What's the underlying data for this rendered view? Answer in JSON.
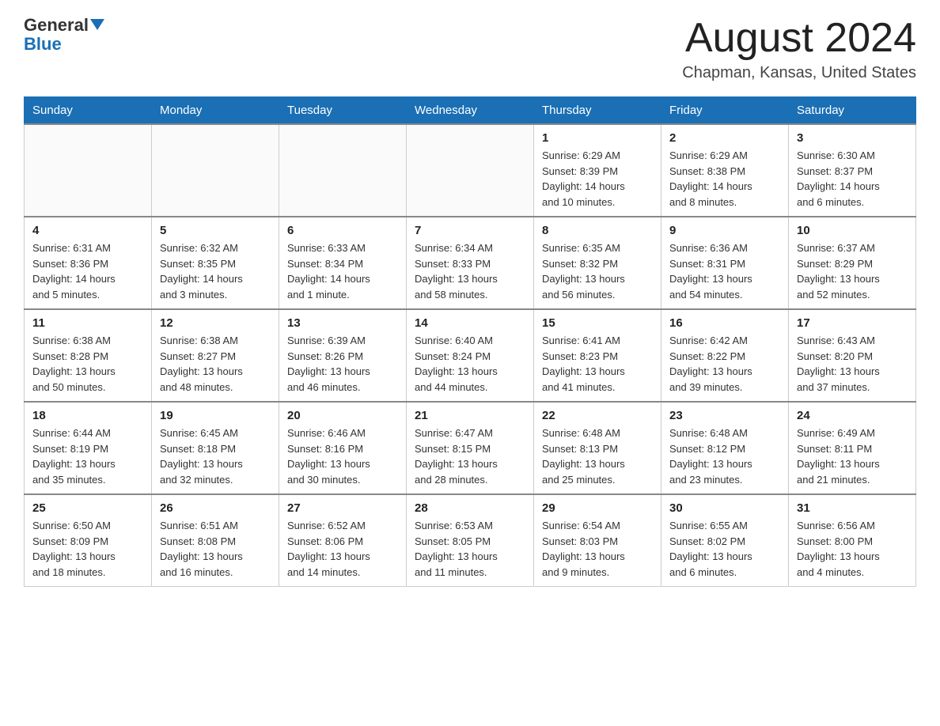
{
  "logo": {
    "text_general": "General",
    "text_blue": "Blue"
  },
  "title": "August 2024",
  "location": "Chapman, Kansas, United States",
  "weekdays": [
    "Sunday",
    "Monday",
    "Tuesday",
    "Wednesday",
    "Thursday",
    "Friday",
    "Saturday"
  ],
  "weeks": [
    [
      {
        "day": "",
        "info": ""
      },
      {
        "day": "",
        "info": ""
      },
      {
        "day": "",
        "info": ""
      },
      {
        "day": "",
        "info": ""
      },
      {
        "day": "1",
        "info": "Sunrise: 6:29 AM\nSunset: 8:39 PM\nDaylight: 14 hours\nand 10 minutes."
      },
      {
        "day": "2",
        "info": "Sunrise: 6:29 AM\nSunset: 8:38 PM\nDaylight: 14 hours\nand 8 minutes."
      },
      {
        "day": "3",
        "info": "Sunrise: 6:30 AM\nSunset: 8:37 PM\nDaylight: 14 hours\nand 6 minutes."
      }
    ],
    [
      {
        "day": "4",
        "info": "Sunrise: 6:31 AM\nSunset: 8:36 PM\nDaylight: 14 hours\nand 5 minutes."
      },
      {
        "day": "5",
        "info": "Sunrise: 6:32 AM\nSunset: 8:35 PM\nDaylight: 14 hours\nand 3 minutes."
      },
      {
        "day": "6",
        "info": "Sunrise: 6:33 AM\nSunset: 8:34 PM\nDaylight: 14 hours\nand 1 minute."
      },
      {
        "day": "7",
        "info": "Sunrise: 6:34 AM\nSunset: 8:33 PM\nDaylight: 13 hours\nand 58 minutes."
      },
      {
        "day": "8",
        "info": "Sunrise: 6:35 AM\nSunset: 8:32 PM\nDaylight: 13 hours\nand 56 minutes."
      },
      {
        "day": "9",
        "info": "Sunrise: 6:36 AM\nSunset: 8:31 PM\nDaylight: 13 hours\nand 54 minutes."
      },
      {
        "day": "10",
        "info": "Sunrise: 6:37 AM\nSunset: 8:29 PM\nDaylight: 13 hours\nand 52 minutes."
      }
    ],
    [
      {
        "day": "11",
        "info": "Sunrise: 6:38 AM\nSunset: 8:28 PM\nDaylight: 13 hours\nand 50 minutes."
      },
      {
        "day": "12",
        "info": "Sunrise: 6:38 AM\nSunset: 8:27 PM\nDaylight: 13 hours\nand 48 minutes."
      },
      {
        "day": "13",
        "info": "Sunrise: 6:39 AM\nSunset: 8:26 PM\nDaylight: 13 hours\nand 46 minutes."
      },
      {
        "day": "14",
        "info": "Sunrise: 6:40 AM\nSunset: 8:24 PM\nDaylight: 13 hours\nand 44 minutes."
      },
      {
        "day": "15",
        "info": "Sunrise: 6:41 AM\nSunset: 8:23 PM\nDaylight: 13 hours\nand 41 minutes."
      },
      {
        "day": "16",
        "info": "Sunrise: 6:42 AM\nSunset: 8:22 PM\nDaylight: 13 hours\nand 39 minutes."
      },
      {
        "day": "17",
        "info": "Sunrise: 6:43 AM\nSunset: 8:20 PM\nDaylight: 13 hours\nand 37 minutes."
      }
    ],
    [
      {
        "day": "18",
        "info": "Sunrise: 6:44 AM\nSunset: 8:19 PM\nDaylight: 13 hours\nand 35 minutes."
      },
      {
        "day": "19",
        "info": "Sunrise: 6:45 AM\nSunset: 8:18 PM\nDaylight: 13 hours\nand 32 minutes."
      },
      {
        "day": "20",
        "info": "Sunrise: 6:46 AM\nSunset: 8:16 PM\nDaylight: 13 hours\nand 30 minutes."
      },
      {
        "day": "21",
        "info": "Sunrise: 6:47 AM\nSunset: 8:15 PM\nDaylight: 13 hours\nand 28 minutes."
      },
      {
        "day": "22",
        "info": "Sunrise: 6:48 AM\nSunset: 8:13 PM\nDaylight: 13 hours\nand 25 minutes."
      },
      {
        "day": "23",
        "info": "Sunrise: 6:48 AM\nSunset: 8:12 PM\nDaylight: 13 hours\nand 23 minutes."
      },
      {
        "day": "24",
        "info": "Sunrise: 6:49 AM\nSunset: 8:11 PM\nDaylight: 13 hours\nand 21 minutes."
      }
    ],
    [
      {
        "day": "25",
        "info": "Sunrise: 6:50 AM\nSunset: 8:09 PM\nDaylight: 13 hours\nand 18 minutes."
      },
      {
        "day": "26",
        "info": "Sunrise: 6:51 AM\nSunset: 8:08 PM\nDaylight: 13 hours\nand 16 minutes."
      },
      {
        "day": "27",
        "info": "Sunrise: 6:52 AM\nSunset: 8:06 PM\nDaylight: 13 hours\nand 14 minutes."
      },
      {
        "day": "28",
        "info": "Sunrise: 6:53 AM\nSunset: 8:05 PM\nDaylight: 13 hours\nand 11 minutes."
      },
      {
        "day": "29",
        "info": "Sunrise: 6:54 AM\nSunset: 8:03 PM\nDaylight: 13 hours\nand 9 minutes."
      },
      {
        "day": "30",
        "info": "Sunrise: 6:55 AM\nSunset: 8:02 PM\nDaylight: 13 hours\nand 6 minutes."
      },
      {
        "day": "31",
        "info": "Sunrise: 6:56 AM\nSunset: 8:00 PM\nDaylight: 13 hours\nand 4 minutes."
      }
    ]
  ]
}
